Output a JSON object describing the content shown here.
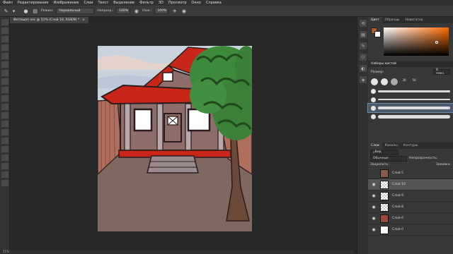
{
  "menu": [
    "Файл",
    "Редактирование",
    "Изображение",
    "Слои",
    "Текст",
    "Выделение",
    "Фильтр",
    "3D",
    "Просмотр",
    "Окно",
    "Справка"
  ],
  "options": {
    "mode_label": "Режим:",
    "mode_value": "Нормальный",
    "opacity_label": "Непрозр.:",
    "opacity_value": "100%",
    "flow_label": "Наж.:",
    "flow_value": "100%"
  },
  "document": {
    "tab_title": "Фотошоп лес @ 51% (Слой 10, RGB/8) *",
    "close": "×"
  },
  "status": {
    "zoom": "51%"
  },
  "color_panel": {
    "tabs": [
      "Цвет",
      "Образцы",
      "Навигатор"
    ],
    "foreground": "#b35a2a",
    "background": "#ffffff"
  },
  "brush_panel": {
    "title": "Наборы кистей",
    "size_label": "Размер:",
    "size_value": "8 пикс.",
    "presets": [
      "30",
      "50"
    ]
  },
  "layers_panel": {
    "tabs": [
      "Слои",
      "Каналы",
      "Контуры"
    ],
    "filter_label": "Вид",
    "blend_mode": "Обычные",
    "opacity_label": "Непрозрачность:",
    "lock_label": "Закрепить:",
    "fill_label": "Заливка:",
    "layers": [
      {
        "name": "Слой 5",
        "visible": false,
        "selected": false
      },
      {
        "name": "Слой 10",
        "visible": true,
        "selected": true
      },
      {
        "name": "Слой 9",
        "visible": true,
        "selected": false
      },
      {
        "name": "Слой 8",
        "visible": true,
        "selected": false
      },
      {
        "name": "Слой 6",
        "visible": true,
        "selected": false
      },
      {
        "name": "Слой 0",
        "visible": true,
        "selected": false
      }
    ]
  }
}
